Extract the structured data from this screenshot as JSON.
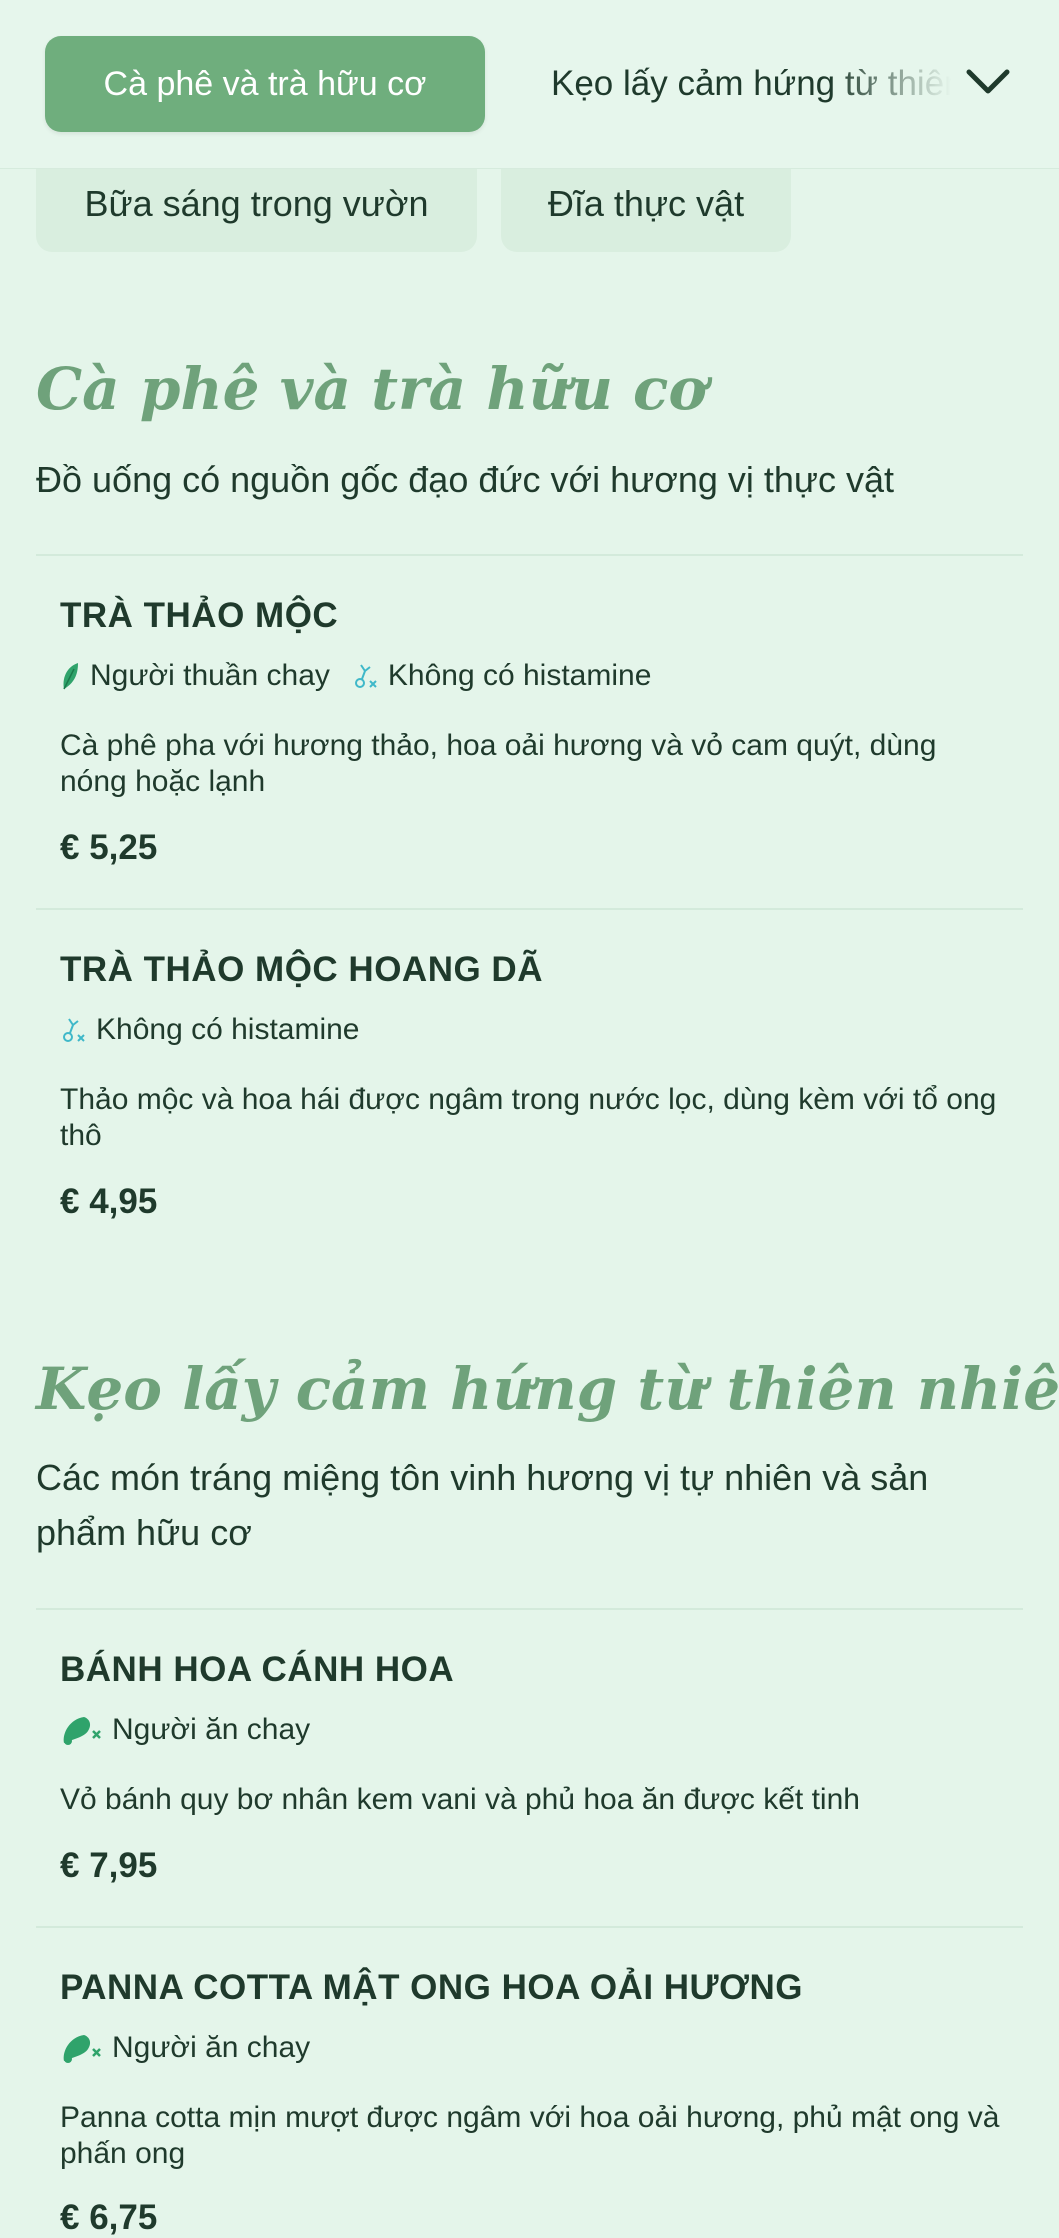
{
  "nav": {
    "active_tab": "Cà phê và trà hữu cơ",
    "next_tab": "Kẹo lấy cảm hứng từ thiên nhiên",
    "pills": [
      "Bữa sáng trong vườn",
      "Đĩa thực vật"
    ]
  },
  "sections": [
    {
      "title": "Cà phê và trà hữu cơ",
      "subtitle": "Đồ uống có nguồn gốc đạo đức với hương vị thực vật",
      "items": [
        {
          "name": "TRÀ THẢO MỘC",
          "tags": [
            {
              "label": "Người thuần chay",
              "icon": "leaf-icon"
            },
            {
              "label": "Không có histamine",
              "icon": "histamine-free-icon"
            }
          ],
          "description": "Cà phê pha với hương thảo, hoa oải hương và vỏ cam quýt, dùng nóng hoặc lạnh",
          "price": "€ 5,25"
        },
        {
          "name": "TRÀ THẢO MỘC HOANG DÃ",
          "tags": [
            {
              "label": "Không có histamine",
              "icon": "histamine-free-icon"
            }
          ],
          "description": "Thảo mộc và hoa hái được ngâm trong nước lọc, dùng kèm với tổ ong thô",
          "price": "€ 4,95"
        }
      ]
    },
    {
      "title": "Kẹo lấy cảm hứng từ thiên nhiên",
      "subtitle": "Các món tráng miệng tôn vinh hương vị tự nhiên và sản phẩm hữu cơ",
      "items": [
        {
          "name": "BÁNH HOA CÁNH HOA",
          "tags": [
            {
              "label": "Người ăn chay",
              "icon": "no-meat-icon"
            }
          ],
          "description": "Vỏ bánh quy bơ nhân kem vani và phủ hoa ăn được kết tinh",
          "price": "€ 7,95"
        },
        {
          "name": "PANNA COTTA MẬT ONG HOA OẢI HƯƠNG",
          "tags": [
            {
              "label": "Người ăn chay",
              "icon": "no-meat-icon"
            }
          ],
          "description": "Panna cotta mịn mượt được ngâm với hoa oải hương, phủ mật ong và phấn ong",
          "price": "€ 6,75"
        }
      ]
    }
  ],
  "colors": {
    "background": "#e4f5ea",
    "accent": "#6fae7d",
    "title": "#6fa27b",
    "text": "#1f3a2c",
    "icon_green": "#2fa36b",
    "icon_teal": "#3fb8c9"
  }
}
